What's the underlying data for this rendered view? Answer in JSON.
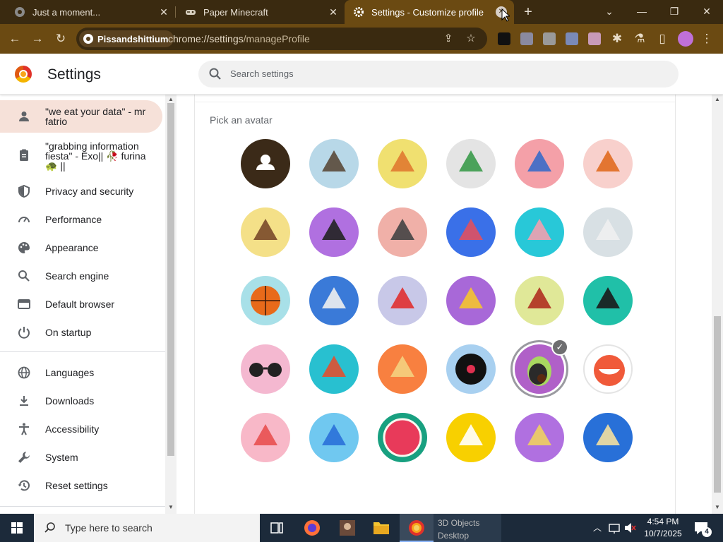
{
  "tabs": [
    {
      "title": "Just a moment...",
      "active": false
    },
    {
      "title": "Paper Minecraft",
      "active": false
    },
    {
      "title": "Settings - Customize profile",
      "active": true
    }
  ],
  "toolbar": {
    "site_name": "Pissandshittium",
    "url_host": "chrome://settings",
    "url_path": "/manageProfile"
  },
  "header": {
    "title": "Settings",
    "search_placeholder": "Search settings"
  },
  "sidebar": {
    "items": [
      {
        "label": "\"we eat your data\" - mr fatrio",
        "icon": "person-icon",
        "active": true
      },
      {
        "label": "\"grabbing information fiesta\" - Exo|| 🥀 furina 🐢 ||",
        "icon": "clipboard-icon",
        "active": false
      },
      {
        "label": "Privacy and security",
        "icon": "shield-icon",
        "active": false
      },
      {
        "label": "Performance",
        "icon": "speedometer-icon",
        "active": false
      },
      {
        "label": "Appearance",
        "icon": "palette-icon",
        "active": false
      },
      {
        "label": "Search engine",
        "icon": "search-icon",
        "active": false
      },
      {
        "label": "Default browser",
        "icon": "browser-window-icon",
        "active": false
      },
      {
        "label": "On startup",
        "icon": "power-icon",
        "active": false
      },
      {
        "label": "Languages",
        "icon": "globe-icon",
        "active": false
      },
      {
        "label": "Downloads",
        "icon": "download-icon",
        "active": false
      },
      {
        "label": "Accessibility",
        "icon": "accessibility-icon",
        "active": false
      },
      {
        "label": "System",
        "icon": "wrench-icon",
        "active": false
      },
      {
        "label": "Reset settings",
        "icon": "history-icon",
        "active": false
      }
    ]
  },
  "main": {
    "section_label": "Pick an avatar",
    "selected_avatar": "avocado",
    "avatars": [
      {
        "name": "generic-person",
        "bg": "#3b2a18"
      },
      {
        "name": "cat",
        "bg": "#b8d8e8"
      },
      {
        "name": "fox",
        "bg": "#f0e070"
      },
      {
        "name": "dragon",
        "bg": "#e4e4e4"
      },
      {
        "name": "elephant",
        "bg": "#f4a0a8"
      },
      {
        "name": "fox-alt",
        "bg": "#f8d0cc"
      },
      {
        "name": "monkey",
        "bg": "#f4e088"
      },
      {
        "name": "panda",
        "bg": "#b070e0"
      },
      {
        "name": "penguin",
        "bg": "#f0b0a8"
      },
      {
        "name": "butterfly",
        "bg": "#3a70e8"
      },
      {
        "name": "rabbit",
        "bg": "#28c8d8"
      },
      {
        "name": "unicorn",
        "bg": "#d8e0e4"
      },
      {
        "name": "basketball",
        "bg": "#a8e0e8"
      },
      {
        "name": "bike",
        "bg": "#3a7ad8"
      },
      {
        "name": "bird",
        "bg": "#c8c8e8"
      },
      {
        "name": "cheese",
        "bg": "#a868d8"
      },
      {
        "name": "football",
        "bg": "#e0e898"
      },
      {
        "name": "sushi-plate",
        "bg": "#20c0a8"
      },
      {
        "name": "sunglasses",
        "bg": "#f4b8d0"
      },
      {
        "name": "sushi",
        "bg": "#28c0d0"
      },
      {
        "name": "tamagotchi",
        "bg": "#f88040"
      },
      {
        "name": "vinyl",
        "bg": "#a8d0f0"
      },
      {
        "name": "avocado",
        "bg": "#b060c8"
      },
      {
        "name": "smile",
        "bg": "#ffffff"
      },
      {
        "name": "ice-cream",
        "bg": "#f8b8c8"
      },
      {
        "name": "cubes",
        "bg": "#70c8f0"
      },
      {
        "name": "watermelon",
        "bg": "#18a080"
      },
      {
        "name": "onigiri",
        "bg": "#f8d000"
      },
      {
        "name": "pizza",
        "bg": "#b070e0"
      },
      {
        "name": "sandwich",
        "bg": "#2870d8"
      }
    ]
  },
  "taskbar": {
    "search_placeholder": "Type here to search",
    "peek_text": "3D Objects\nDesktop",
    "time": "4:54 PM",
    "date": "10/7/2025",
    "notification_count": "4"
  }
}
